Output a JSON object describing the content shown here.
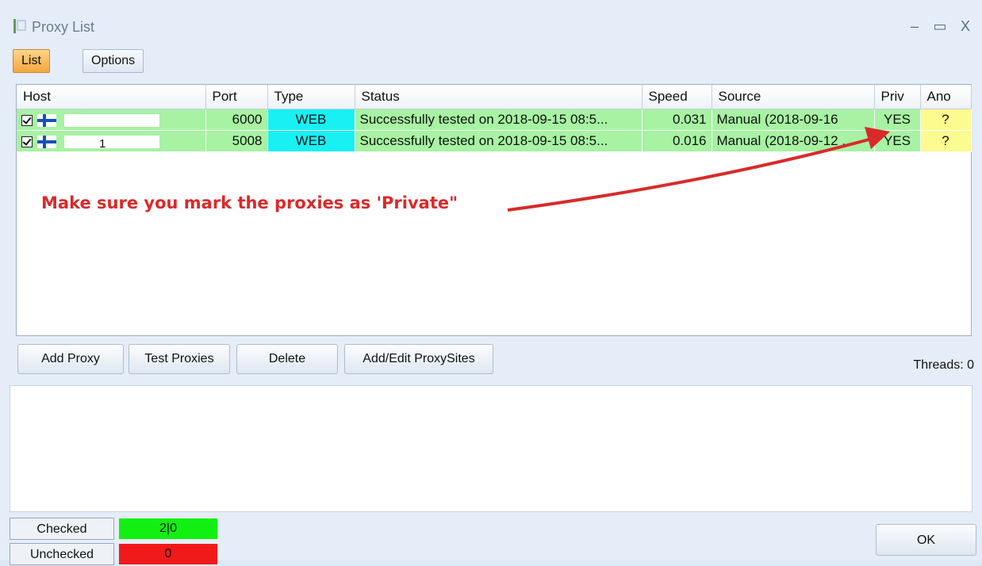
{
  "window": {
    "title": "Proxy List",
    "minimize": "–",
    "maximize": "▭",
    "close": "X"
  },
  "tabs": [
    {
      "label": "List",
      "active": true
    },
    {
      "label": "Options",
      "active": false
    }
  ],
  "table": {
    "columns": [
      "Host",
      "Port",
      "Type",
      "Status",
      "Speed",
      "Source",
      "Priv",
      "Ano"
    ],
    "rows": [
      {
        "checked": true,
        "flag": "finland-flag",
        "host": "",
        "port": "6000",
        "type": "WEB",
        "status": "Successfully tested on 2018-09-15 08:5...",
        "speed": "0.031",
        "source": "Manual (2018-09-16",
        "priv": "YES",
        "ano": "?"
      },
      {
        "checked": true,
        "flag": "finland-flag",
        "host": "1",
        "port": "5008",
        "type": "WEB",
        "status": "Successfully tested on 2018-09-15 08:5...",
        "speed": "0.016",
        "source": "Manual (2018-09-12 ...",
        "priv": "YES",
        "ano": "?"
      }
    ]
  },
  "annotation": {
    "text": "Make sure you mark the proxies as 'Private\"",
    "color": "#d92a2a"
  },
  "buttons": {
    "add_proxy": "Add Proxy",
    "test_proxies": "Test Proxies",
    "delete": "Delete",
    "add_edit_proxysites": "Add/Edit ProxySites",
    "ok": "OK"
  },
  "threads": "Threads: 0",
  "stats": {
    "checked_label": "Checked",
    "checked_value": "2|0",
    "checked_color": "#11f011",
    "unchecked_label": "Unchecked",
    "unchecked_value": "0",
    "unchecked_color": "#f01a1a"
  },
  "colors": {
    "row_green": "#a7f2a3",
    "type_cyan": "#19f0f4",
    "ano_yellow": "#fbfb8f",
    "active_tab": "#f4a640"
  }
}
